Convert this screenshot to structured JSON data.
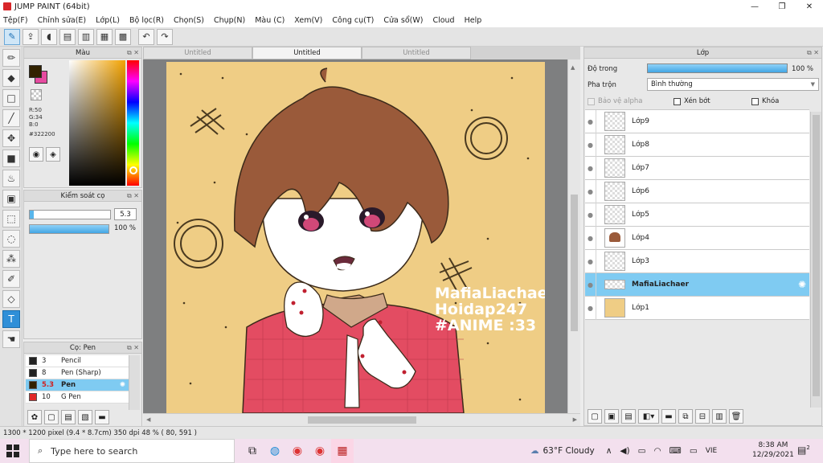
{
  "window": {
    "title": "JUMP PAINT (64bit)",
    "minimize": "—",
    "maximize": "❐",
    "close": "✕"
  },
  "menu": [
    "Tệp(F)",
    "Chỉnh sửa(E)",
    "Lớp(L)",
    "Bộ lọc(R)",
    "Chọn(S)",
    "Chụp(N)",
    "Màu (C)",
    "Xem(V)",
    "Công cụ(T)",
    "Cửa sổ(W)",
    "Cloud",
    "Help"
  ],
  "color_panel": {
    "title": "Màu",
    "r": "R:50",
    "g": "G:34",
    "b": "B:0",
    "hex": "#322200",
    "fg_color": "#322200",
    "bg_color": "#e64ba0"
  },
  "brush_control": {
    "title": "Kiểm soát cọ",
    "size": "5.3",
    "opacity": "100 %",
    "size_level": 0.05,
    "opacity_level": 1.0
  },
  "brush_list": {
    "title": "Cọ: Pen",
    "items": [
      {
        "size": "3",
        "name": "Pencil",
        "color": "#222222",
        "selected": false
      },
      {
        "size": "8",
        "name": "Pen (Sharp)",
        "color": "#222222",
        "selected": false
      },
      {
        "size": "5.3",
        "name": "Pen",
        "color": "#322200",
        "selected": true
      },
      {
        "size": "10",
        "name": "G Pen",
        "color": "#e02828",
        "selected": false
      }
    ]
  },
  "tabs": [
    {
      "label": "Untitled",
      "active": false
    },
    {
      "label": "Untitled",
      "active": true
    },
    {
      "label": "Untitled",
      "active": false
    }
  ],
  "canvas": {
    "watermark_lines": [
      "MafiaLiachaer",
      "Hoidap247",
      "#ANIME :33"
    ],
    "background": "#efcd85"
  },
  "layer_panel": {
    "title": "Lớp",
    "opacity_label": "Độ trong",
    "opacity_value": "100 %",
    "blend_label": "Pha trộn",
    "blend_value": "Bình thường",
    "protect_alpha": "Bảo vệ alpha",
    "clipping": "Xén bớt",
    "lock": "Khóa",
    "layers": [
      {
        "name": "Lớp9",
        "selected": false
      },
      {
        "name": "Lớp8",
        "selected": false
      },
      {
        "name": "Lớp7",
        "selected": false
      },
      {
        "name": "Lớp6",
        "selected": false
      },
      {
        "name": "Lớp5",
        "selected": false
      },
      {
        "name": "Lớp4",
        "selected": false
      },
      {
        "name": "Lớp3",
        "selected": false
      },
      {
        "name": "MafiaLiachaer",
        "selected": true
      },
      {
        "name": "Lớp1",
        "selected": false
      }
    ]
  },
  "status": {
    "text": "1300 * 1200 pixel  (9.4 * 8.7cm)  350 dpi  48 %  ( 80, 591 )"
  },
  "taskbar": {
    "search_placeholder": "Type here to search",
    "weather": "63°F  Cloudy",
    "lang": "VIE",
    "time": "8:38 AM",
    "date": "12/29/2021",
    "notif_count": "2"
  },
  "colors": {
    "accent": "#2f8fd8",
    "selected_row": "#7fcbf2"
  }
}
